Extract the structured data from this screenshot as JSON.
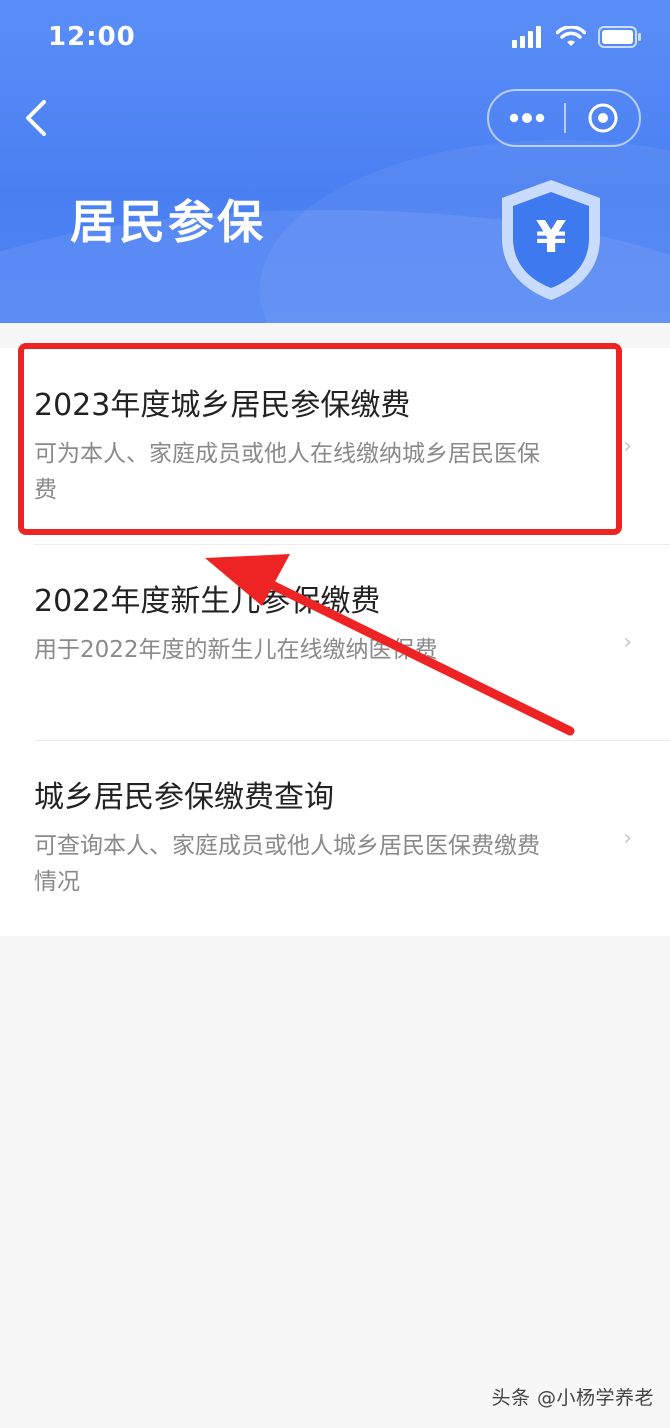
{
  "status_bar": {
    "time": "12:00"
  },
  "header": {
    "title": "居民参保",
    "shield_symbol": "¥",
    "icons": {
      "back": "back-chevron-icon",
      "more": "more-dots-icon",
      "close": "target-close-icon",
      "shield": "shield-yen-icon"
    }
  },
  "items": [
    {
      "title": "2023年度城乡居民参保缴费",
      "desc": "可为本人、家庭成员或他人在线缴纳城乡居民医保费",
      "chevron": "›"
    },
    {
      "title": "2022年度新生儿参保缴费",
      "desc": "用于2022年度的新生儿在线缴纳医保费",
      "chevron": "›"
    },
    {
      "title": "城乡居民参保缴费查询",
      "desc": "可查询本人、家庭成员或他人城乡居民医保费缴费情况",
      "chevron": "›"
    }
  ],
  "annotation": {
    "box_color": "#ee2424",
    "arrow_color": "#ee2424"
  },
  "watermark": "头条 @小杨学养老"
}
